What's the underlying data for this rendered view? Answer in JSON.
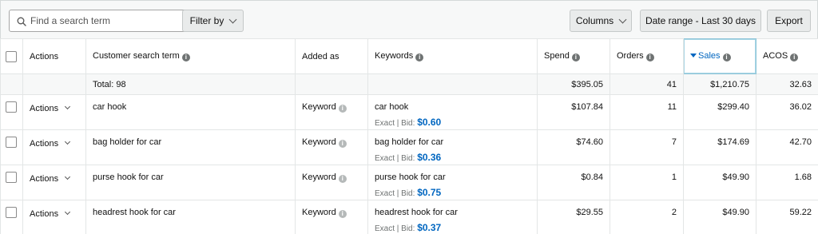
{
  "toolbar": {
    "search_placeholder": "Find a search term",
    "filter_label": "Filter by",
    "columns_label": "Columns",
    "date_range_label": "Date range - Last 30 days",
    "export_label": "Export"
  },
  "columns": {
    "actions": "Actions",
    "search_term": "Customer search term",
    "added_as": "Added as",
    "keywords": "Keywords",
    "spend": "Spend",
    "orders": "Orders",
    "sales": "Sales",
    "acos": "ACOS"
  },
  "totals": {
    "label": "Total: 98",
    "spend": "$395.05",
    "orders": "41",
    "sales": "$1,210.75",
    "acos": "32.63"
  },
  "rows": [
    {
      "actions": "Actions",
      "term": "car hook",
      "added_as": "Keyword",
      "keyword": "car hook",
      "match": "Exact | Bid:",
      "bid": "$0.60",
      "spend": "$107.84",
      "orders": "11",
      "sales": "$299.40",
      "acos": "36.02"
    },
    {
      "actions": "Actions",
      "term": "bag holder for car",
      "added_as": "Keyword",
      "keyword": "bag holder for car",
      "match": "Exact | Bid:",
      "bid": "$0.36",
      "spend": "$74.60",
      "orders": "7",
      "sales": "$174.69",
      "acos": "42.70"
    },
    {
      "actions": "Actions",
      "term": "purse hook for car",
      "added_as": "Keyword",
      "keyword": "purse hook for car",
      "match": "Exact | Bid:",
      "bid": "$0.75",
      "spend": "$0.84",
      "orders": "1",
      "sales": "$49.90",
      "acos": "1.68"
    },
    {
      "actions": "Actions",
      "term": "headrest hook for car",
      "added_as": "Keyword",
      "keyword": "headrest hook for car",
      "match": "Exact | Bid:",
      "bid": "$0.37",
      "spend": "$29.55",
      "orders": "2",
      "sales": "$49.90",
      "acos": "59.22"
    }
  ],
  "colors": {
    "accent": "#0066c0",
    "header_bg": "#f7f8f8",
    "border": "#e3e6e6"
  },
  "icons": {
    "search": "search-icon",
    "info": "info-icon",
    "chevron": "chevron-down-icon",
    "sort": "sort-descending-icon"
  }
}
